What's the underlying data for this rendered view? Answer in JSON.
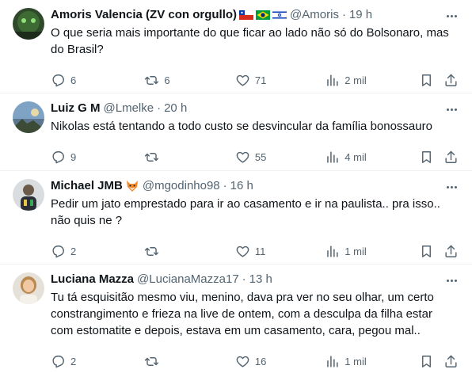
{
  "tweets": [
    {
      "name": "Amoris Valencia (ZV con orgullo)",
      "handle": "@Amoris",
      "sep": "·",
      "time": "19 h",
      "text": "O que seria mais importante do que ficar ao lado não só do Bolsonaro, mas\ndo Brasil?",
      "replies": "6",
      "retweets": "6",
      "likes": "71",
      "views": "2 mil",
      "name_icons": [
        "chile-flag-icon",
        "brazil-flag-icon",
        "israel-flag-icon"
      ]
    },
    {
      "name": "Luiz G M",
      "handle": "@Lmelke",
      "sep": "·",
      "time": "20 h",
      "text": "Nikolas está tentando a todo custo se desvincular da família bonossauro",
      "replies": "9",
      "retweets": "",
      "likes": "55",
      "views": "4 mil"
    },
    {
      "name": "Michael JMB",
      "handle": "@mgodinho98",
      "sep": "·",
      "time": "16 h",
      "text": "Pedir um jato emprestado para ir ao casamento e ir na paulista.. pra isso..\nnão quis ne ?",
      "replies": "2",
      "retweets": "",
      "likes": "11",
      "views": "1 mil",
      "name_icons": [
        "fox-emoji-icon"
      ]
    },
    {
      "name": "Luciana Mazza",
      "handle": "@LucianaMazza17",
      "sep": "·",
      "time": "13 h",
      "text": "Tu tá esquisitão mesmo viu, menino, dava pra ver no seu olhar, um certo\nconstrangimento e frieza na live de ontem,  com a desculpa da filha estar\ncom estomatite e depois, estava em um casamento, cara, pegou mal..",
      "replies": "2",
      "retweets": "",
      "likes": "16",
      "views": "1 mil"
    }
  ],
  "colors": {
    "text": "#0f1419",
    "secondary": "#536471",
    "divider": "#eff3f4"
  }
}
